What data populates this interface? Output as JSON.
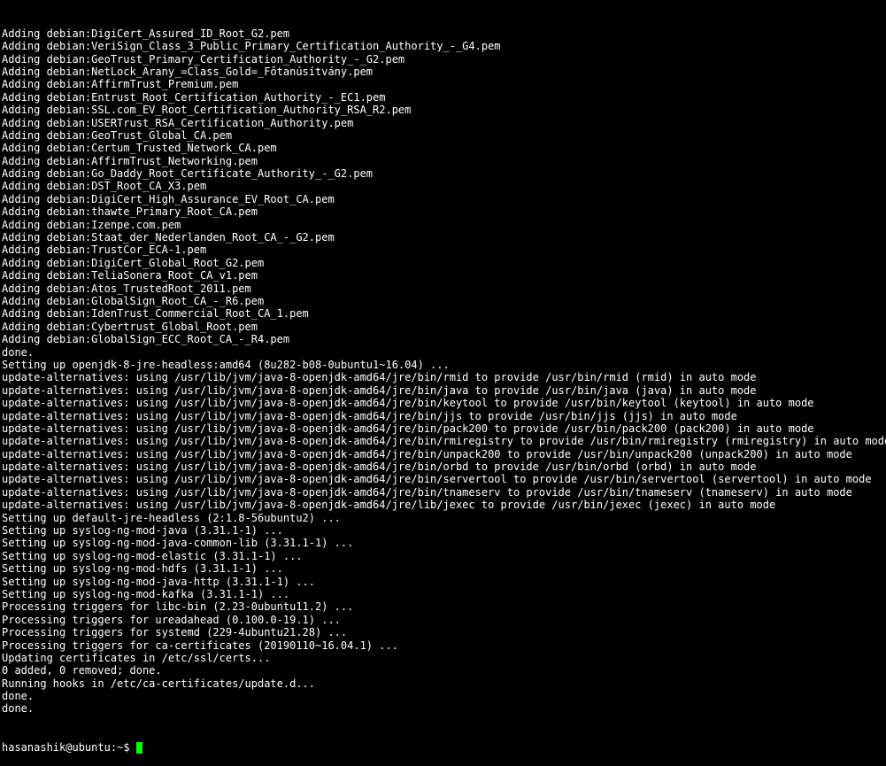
{
  "lines": [
    "Adding debian:DigiCert_Assured_ID_Root_G2.pem",
    "Adding debian:VeriSign_Class_3_Public_Primary_Certification_Authority_-_G4.pem",
    "Adding debian:GeoTrust_Primary_Certification_Authority_-_G2.pem",
    "Adding debian:NetLock_Arany_=Class_Gold=_Főtanúsítvány.pem",
    "Adding debian:AffirmTrust_Premium.pem",
    "Adding debian:Entrust_Root_Certification_Authority_-_EC1.pem",
    "Adding debian:SSL.com_EV_Root_Certification_Authority_RSA_R2.pem",
    "Adding debian:USERTrust_RSA_Certification_Authority.pem",
    "Adding debian:GeoTrust_Global_CA.pem",
    "Adding debian:Certum_Trusted_Network_CA.pem",
    "Adding debian:AffirmTrust_Networking.pem",
    "Adding debian:Go_Daddy_Root_Certificate_Authority_-_G2.pem",
    "Adding debian:DST_Root_CA_X3.pem",
    "Adding debian:DigiCert_High_Assurance_EV_Root_CA.pem",
    "Adding debian:thawte_Primary_Root_CA.pem",
    "Adding debian:Izenpe.com.pem",
    "Adding debian:Staat_der_Nederlanden_Root_CA_-_G2.pem",
    "Adding debian:TrustCor_ECA-1.pem",
    "Adding debian:DigiCert_Global_Root_G2.pem",
    "Adding debian:TeliaSonera_Root_CA_v1.pem",
    "Adding debian:Atos_TrustedRoot_2011.pem",
    "Adding debian:GlobalSign_Root_CA_-_R6.pem",
    "Adding debian:IdenTrust_Commercial_Root_CA_1.pem",
    "Adding debian:Cybertrust_Global_Root.pem",
    "Adding debian:GlobalSign_ECC_Root_CA_-_R4.pem",
    "done.",
    "Setting up openjdk-8-jre-headless:amd64 (8u282-b08-0ubuntu1~16.04) ...",
    "update-alternatives: using /usr/lib/jvm/java-8-openjdk-amd64/jre/bin/rmid to provide /usr/bin/rmid (rmid) in auto mode",
    "update-alternatives: using /usr/lib/jvm/java-8-openjdk-amd64/jre/bin/java to provide /usr/bin/java (java) in auto mode",
    "update-alternatives: using /usr/lib/jvm/java-8-openjdk-amd64/jre/bin/keytool to provide /usr/bin/keytool (keytool) in auto mode",
    "update-alternatives: using /usr/lib/jvm/java-8-openjdk-amd64/jre/bin/jjs to provide /usr/bin/jjs (jjs) in auto mode",
    "update-alternatives: using /usr/lib/jvm/java-8-openjdk-amd64/jre/bin/pack200 to provide /usr/bin/pack200 (pack200) in auto mode",
    "update-alternatives: using /usr/lib/jvm/java-8-openjdk-amd64/jre/bin/rmiregistry to provide /usr/bin/rmiregistry (rmiregistry) in auto mode",
    "update-alternatives: using /usr/lib/jvm/java-8-openjdk-amd64/jre/bin/unpack200 to provide /usr/bin/unpack200 (unpack200) in auto mode",
    "update-alternatives: using /usr/lib/jvm/java-8-openjdk-amd64/jre/bin/orbd to provide /usr/bin/orbd (orbd) in auto mode",
    "update-alternatives: using /usr/lib/jvm/java-8-openjdk-amd64/jre/bin/servertool to provide /usr/bin/servertool (servertool) in auto mode",
    "update-alternatives: using /usr/lib/jvm/java-8-openjdk-amd64/jre/bin/tnameserv to provide /usr/bin/tnameserv (tnameserv) in auto mode",
    "update-alternatives: using /usr/lib/jvm/java-8-openjdk-amd64/jre/lib/jexec to provide /usr/bin/jexec (jexec) in auto mode",
    "Setting up default-jre-headless (2:1.8-56ubuntu2) ...",
    "Setting up syslog-ng-mod-java (3.31.1-1) ...",
    "Setting up syslog-ng-mod-java-common-lib (3.31.1-1) ...",
    "Setting up syslog-ng-mod-elastic (3.31.1-1) ...",
    "Setting up syslog-ng-mod-hdfs (3.31.1-1) ...",
    "Setting up syslog-ng-mod-java-http (3.31.1-1) ...",
    "Setting up syslog-ng-mod-kafka (3.31.1-1) ...",
    "Processing triggers for libc-bin (2.23-0ubuntu11.2) ...",
    "Processing triggers for ureadahead (0.100.0-19.1) ...",
    "Processing triggers for systemd (229-4ubuntu21.28) ...",
    "Processing triggers for ca-certificates (20190110~16.04.1) ...",
    "Updating certificates in /etc/ssl/certs...",
    "0 added, 0 removed; done.",
    "Running hooks in /etc/ca-certificates/update.d...",
    "",
    "done.",
    "done."
  ],
  "prompt": {
    "user": "hasanashik",
    "host": "ubuntu",
    "separator1": "@",
    "separator2": ":",
    "path": "~",
    "symbol": "$"
  }
}
